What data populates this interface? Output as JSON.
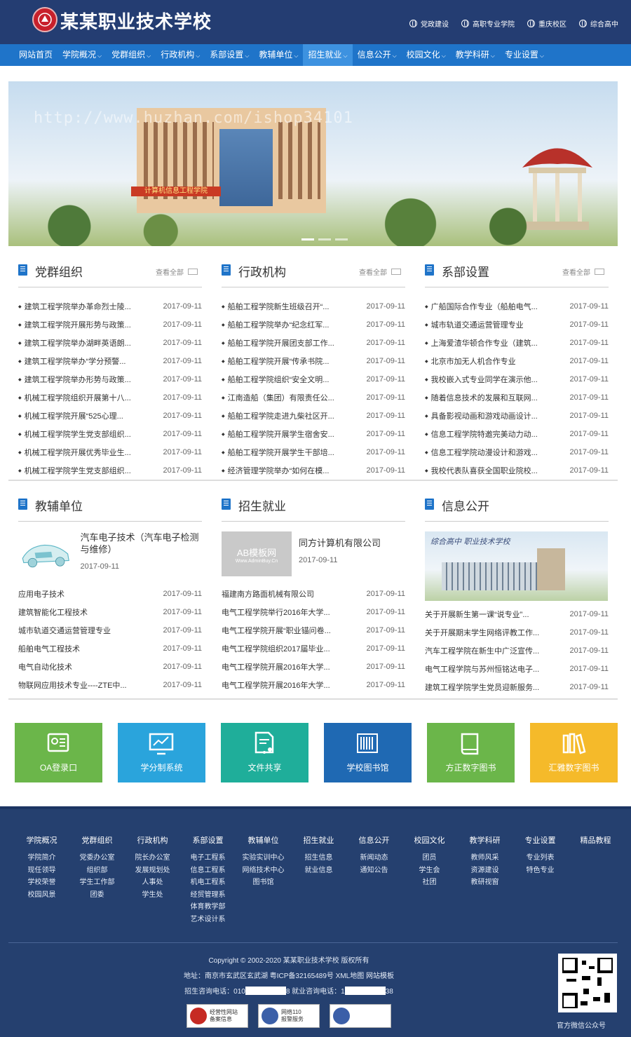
{
  "header": {
    "site_title": "某某职业技术学校",
    "top_links": [
      "党政建设",
      "高职专业学院",
      "重庆校区",
      "综合高中"
    ]
  },
  "nav": {
    "items": [
      "网站首页",
      "学院概况",
      "党群组织",
      "行政机构",
      "系部设置",
      "教辅单位",
      "招生就业",
      "信息公开",
      "校园文化",
      "教学科研",
      "专业设置"
    ],
    "active": "招生就业"
  },
  "banner": {
    "watermark": "http://www.huzhan.com/ishop34101",
    "sign_text": "计算机信息工程学院"
  },
  "more_label": "查看全部",
  "sections": {
    "party": {
      "title": "党群组织",
      "items": [
        {
          "t": "建筑工程学院举办革命烈士陵...",
          "d": "2017-09-11"
        },
        {
          "t": "建筑工程学院开展形势与政策...",
          "d": "2017-09-11"
        },
        {
          "t": "建筑工程学院举办湖畔英语朗...",
          "d": "2017-09-11"
        },
        {
          "t": "建筑工程学院举办“学分预警...",
          "d": "2017-09-11"
        },
        {
          "t": "建筑工程学院举办形势与政策...",
          "d": "2017-09-11"
        },
        {
          "t": "机械工程学院组织开展第十八...",
          "d": "2017-09-11"
        },
        {
          "t": "机械工程学院开展“525心理...",
          "d": "2017-09-11"
        },
        {
          "t": "机械工程学院学生党支部组织...",
          "d": "2017-09-11"
        },
        {
          "t": "机械工程学院开展优秀毕业生...",
          "d": "2017-09-11"
        },
        {
          "t": "机械工程学院学生党支部组织...",
          "d": "2017-09-11"
        }
      ]
    },
    "admin": {
      "title": "行政机构",
      "items": [
        {
          "t": "船舶工程学院新生班级召开“...",
          "d": "2017-09-11"
        },
        {
          "t": "船舶工程学院举办“纪念红军...",
          "d": "2017-09-11"
        },
        {
          "t": "船舶工程学院开展团支部工作...",
          "d": "2017-09-11"
        },
        {
          "t": "船舶工程学院开展“传承书院...",
          "d": "2017-09-11"
        },
        {
          "t": "船舶工程学院组织“安全文明...",
          "d": "2017-09-11"
        },
        {
          "t": "江南造船（集团）有限责任公...",
          "d": "2017-09-11"
        },
        {
          "t": "船舶工程学院走进九柴社区开...",
          "d": "2017-09-11"
        },
        {
          "t": "船舶工程学院开展学生宿舍安...",
          "d": "2017-09-11"
        },
        {
          "t": "船舶工程学院开展学生干部培...",
          "d": "2017-09-11"
        },
        {
          "t": "经济管理学院举办“如何在模...",
          "d": "2017-09-11"
        }
      ]
    },
    "dept": {
      "title": "系部设置",
      "items": [
        {
          "t": "广船国际合作专业（船舶电气...",
          "d": "2017-09-11"
        },
        {
          "t": "城市轨道交通运营管理专业",
          "d": "2017-09-11"
        },
        {
          "t": "上海爱渣华顿合作专业（建筑...",
          "d": "2017-09-11"
        },
        {
          "t": "北京市加无人机合作专业",
          "d": "2017-09-11"
        },
        {
          "t": "我校嵌入式专业同学在演示他...",
          "d": "2017-09-11"
        },
        {
          "t": "随着信息技术的发展和互联网...",
          "d": "2017-09-11"
        },
        {
          "t": "具备影视动画和游戏动画设计...",
          "d": "2017-09-11"
        },
        {
          "t": "信息工程学院特邀完美动力动...",
          "d": "2017-09-11"
        },
        {
          "t": "信息工程学院动漫设计和游戏...",
          "d": "2017-09-11"
        },
        {
          "t": "我校代表队喜获全国职业院校...",
          "d": "2017-09-11"
        }
      ]
    },
    "support": {
      "title": "教辅单位",
      "feature": {
        "t": "汽车电子技术（汽车电子检测与维修）",
        "d": "2017-09-11"
      },
      "items": [
        {
          "t": "应用电子技术",
          "d": "2017-09-11"
        },
        {
          "t": "建筑智能化工程技术",
          "d": "2017-09-11"
        },
        {
          "t": "城市轨道交通运营管理专业",
          "d": "2017-09-11"
        },
        {
          "t": "船舶电气工程技术",
          "d": "2017-09-11"
        },
        {
          "t": "电气自动化技术",
          "d": "2017-09-11"
        },
        {
          "t": "物联网应用技术专业----ZTE中...",
          "d": "2017-09-11"
        }
      ]
    },
    "enroll": {
      "title": "招生就业",
      "feature": {
        "t": "同方计算机有限公司",
        "d": "2017-09-11",
        "img_text": "AB模板网",
        "img_sub": "Www.AdminBuy.Cn"
      },
      "items": [
        {
          "t": "福建南方路面机械有限公司",
          "d": "2017-09-11"
        },
        {
          "t": "电气工程学院举行2016年大学...",
          "d": "2017-09-11"
        },
        {
          "t": "电气工程学院开展“职业锚问卷...",
          "d": "2017-09-11"
        },
        {
          "t": "电气工程学院组织2017届毕业...",
          "d": "2017-09-11"
        },
        {
          "t": "电气工程学院开展2016年大学...",
          "d": "2017-09-11"
        },
        {
          "t": "电气工程学院开展2016年大学...",
          "d": "2017-09-11"
        }
      ]
    },
    "info": {
      "title": "信息公开",
      "img_caption": "综合高中 职业技术学校",
      "items": [
        {
          "t": "关于开展新生第一课“说专业”...",
          "d": "2017-09-11"
        },
        {
          "t": "关于开展期末学生网络评教工作...",
          "d": "2017-09-11"
        },
        {
          "t": "汽车工程学院在新生中广泛宣传...",
          "d": "2017-09-11"
        },
        {
          "t": "电气工程学院与苏州恒铭达电子...",
          "d": "2017-09-11"
        },
        {
          "t": "建筑工程学院学生党员迎新服务...",
          "d": "2017-09-11"
        }
      ]
    }
  },
  "tiles": [
    {
      "label": "OA登录口",
      "color": "#6bb64a",
      "icon": "id-card-icon"
    },
    {
      "label": "学分制系统",
      "color": "#2aa4dc",
      "icon": "monitor-chart-icon"
    },
    {
      "label": "文件共享",
      "color": "#1fae9a",
      "icon": "document-share-icon"
    },
    {
      "label": "学校图书馆",
      "color": "#1f69b3",
      "icon": "library-icon"
    },
    {
      "label": "方正数字图书",
      "color": "#6bb64a",
      "icon": "book-icon"
    },
    {
      "label": "汇雅数字图书",
      "color": "#f5ba2a",
      "icon": "books-icon"
    }
  ],
  "footer": {
    "columns": [
      {
        "h": "学院概况",
        "links": [
          "学院简介",
          "现任领导",
          "学校荣誉",
          "校园风景"
        ]
      },
      {
        "h": "党群组织",
        "links": [
          "党委办公室",
          "组织部",
          "学生工作部",
          "团委"
        ]
      },
      {
        "h": "行政机构",
        "links": [
          "院长办公室",
          "发展规划处",
          "人事处",
          "学生处"
        ]
      },
      {
        "h": "系部设置",
        "links": [
          "电子工程系",
          "信息工程系",
          "机电工程系",
          "经贸管理系",
          "体育教学部",
          "艺术设计系"
        ]
      },
      {
        "h": "教辅单位",
        "links": [
          "实验实训中心",
          "网络技术中心",
          "图书馆"
        ]
      },
      {
        "h": "招生就业",
        "links": [
          "招生信息",
          "就业信息"
        ]
      },
      {
        "h": "信息公开",
        "links": [
          "新闻动态",
          "通知公告"
        ]
      },
      {
        "h": "校园文化",
        "links": [
          "团员",
          "学生会",
          "社团"
        ]
      },
      {
        "h": "教学科研",
        "links": [
          "教师风采",
          "资源建设",
          "教研视窗"
        ]
      },
      {
        "h": "专业设置",
        "links": [
          "专业列表",
          "特色专业"
        ]
      },
      {
        "h": "精品教程",
        "links": []
      }
    ],
    "copyright": "Copyright © 2002-2020 某某职业技术学校 版权所有",
    "address": "地址：南京市玄武区玄武湖 粤ICP备32165489号 XML地图 网站模板",
    "phone_prefix": "招生咨询电话：010",
    "phone_mid": "8 就业咨询电话：1",
    "phone_suffix": "38",
    "badges": [
      {
        "text": "经营性网站\n备案信息",
        "color": "#c62a23"
      },
      {
        "text": "网络110\n报警服务",
        "color": "#3b5fa8"
      },
      {
        "text": "",
        "color": "#3b5fa8"
      }
    ],
    "qr_caption": "官方微信公众号"
  }
}
